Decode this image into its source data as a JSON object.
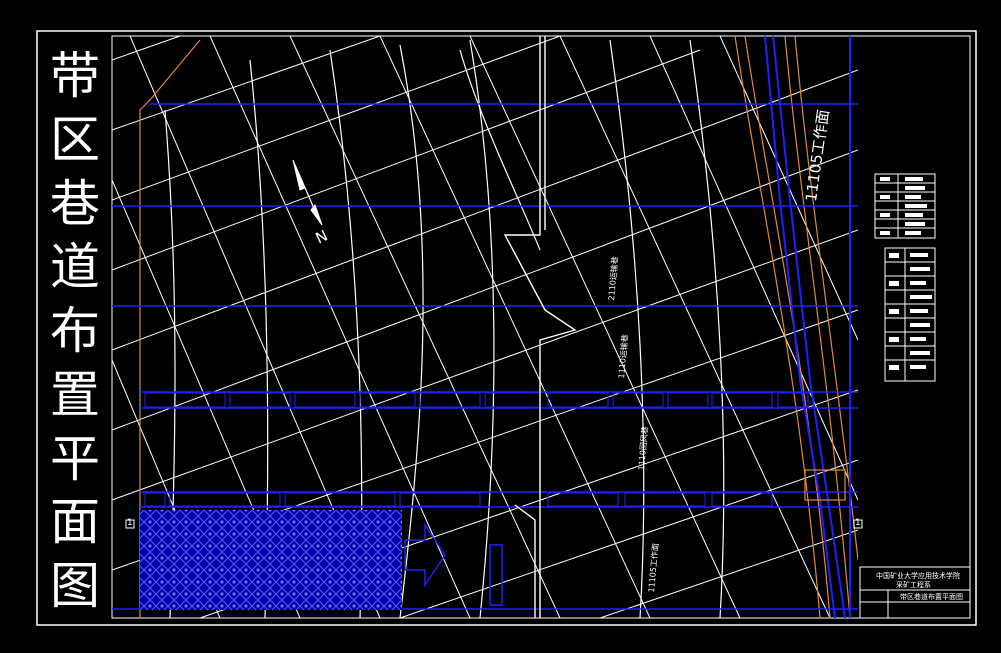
{
  "title_chars": [
    "带",
    "区",
    "巷",
    "道",
    "布",
    "置",
    "平",
    "面",
    "图"
  ],
  "north_label": "N",
  "workface_label_main": "11105工作面",
  "workface_labels_small": [
    "2110运输巷",
    "1110运输巷",
    "1110回风巷",
    "11105工作面"
  ],
  "markers": [
    "1",
    "1"
  ],
  "title_block": {
    "school": "中国矿业大学应用技术学院",
    "department": "采矿工程系",
    "drawing_name": "带区巷道布置平面图"
  },
  "colors": {
    "frame": "#ffffff",
    "roadway": "#1a1aff",
    "grid": "#ffffff",
    "contour": "#ffa040",
    "hatch": "#2222ff"
  }
}
